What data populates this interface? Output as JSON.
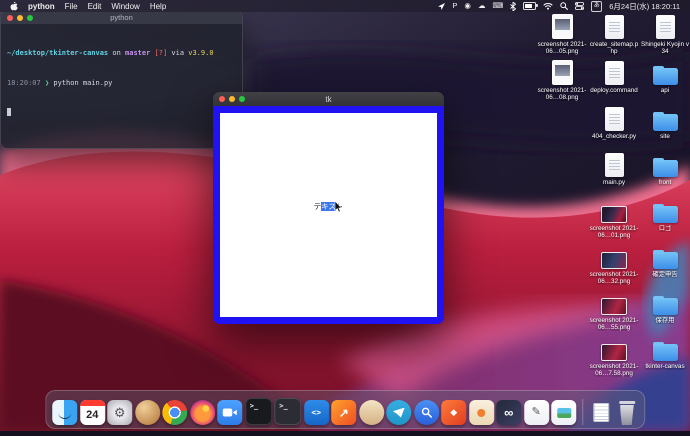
{
  "menu_bar": {
    "app_name": "python",
    "menus": [
      "File",
      "Edit",
      "Window",
      "Help"
    ],
    "datetime": "6月24日(水) 18:20:11",
    "glyphs": {
      "p": "P",
      "record": "◉",
      "cloud": "☁",
      "keyboard": "⌨",
      "ime": "あ"
    }
  },
  "terminal": {
    "title": "python",
    "lines": [
      {
        "s0": "~/desktop/tkinter-canvas",
        "s1": " on ",
        "s2": "master",
        "s3": " [?]",
        "s4": " via ",
        "s5": "v3.9.0"
      },
      {
        "s0": "18:20:07 ",
        "s1": "❯ ",
        "s2": "python main.py"
      }
    ]
  },
  "tk_window": {
    "title": "tk",
    "canvas_text": {
      "before": "テ",
      "selected": "キス",
      "after": "ト"
    },
    "border_color": "#2012f2",
    "selection_color": "#3c78e8"
  },
  "desktop": {
    "columns": [
      {
        "items": [
          {
            "label": "screenshot 2021-06…05.png",
            "type": "image"
          },
          {
            "label": "screenshot 2021-06…08.png",
            "type": "image"
          }
        ]
      },
      {
        "items": [
          {
            "label": "create_sitemap.php",
            "type": "doc"
          },
          {
            "label": "deploy.command",
            "type": "doc"
          },
          {
            "label": "404_checker.py",
            "type": "doc"
          },
          {
            "label": "main.py",
            "type": "doc"
          },
          {
            "label": "screenshot 2021-06…01.png",
            "type": "image"
          },
          {
            "label": "screenshot 2021-06…32.png",
            "type": "image"
          },
          {
            "label": "screenshot 2021-06…55.png",
            "type": "image"
          },
          {
            "label": "screenshot 2021-06…7.58.png",
            "type": "image"
          }
        ]
      },
      {
        "items": [
          {
            "label": "Shingeki Kyojin v34",
            "type": "doc"
          },
          {
            "label": "api",
            "type": "folder"
          },
          {
            "label": "site",
            "type": "folder"
          },
          {
            "label": "front",
            "type": "folder"
          },
          {
            "label": "ロゴ",
            "type": "folder"
          },
          {
            "label": "確定申告",
            "type": "folder"
          },
          {
            "label": "保存用",
            "type": "folder"
          },
          {
            "label": "tkinter-canvas",
            "type": "folder"
          }
        ]
      }
    ]
  },
  "dock": {
    "calendar_day": "24",
    "glyphs": {
      "terminal": ">_",
      "vscode": "<>",
      "chart": "↗",
      "diamond": "◆",
      "infinity": "∞",
      "settings": "⚙",
      "pencil": "✎"
    },
    "apps": [
      "finder",
      "calendar",
      "system-preferences",
      "homebrew",
      "chrome",
      "firefox",
      "video-call",
      "terminal",
      "terminal-alt",
      "vscode",
      "stats",
      "tan-app",
      "telegram",
      "search",
      "orange-app",
      "cream-app",
      "infinity-app",
      "notes",
      "photos",
      "documents",
      "trash"
    ]
  }
}
